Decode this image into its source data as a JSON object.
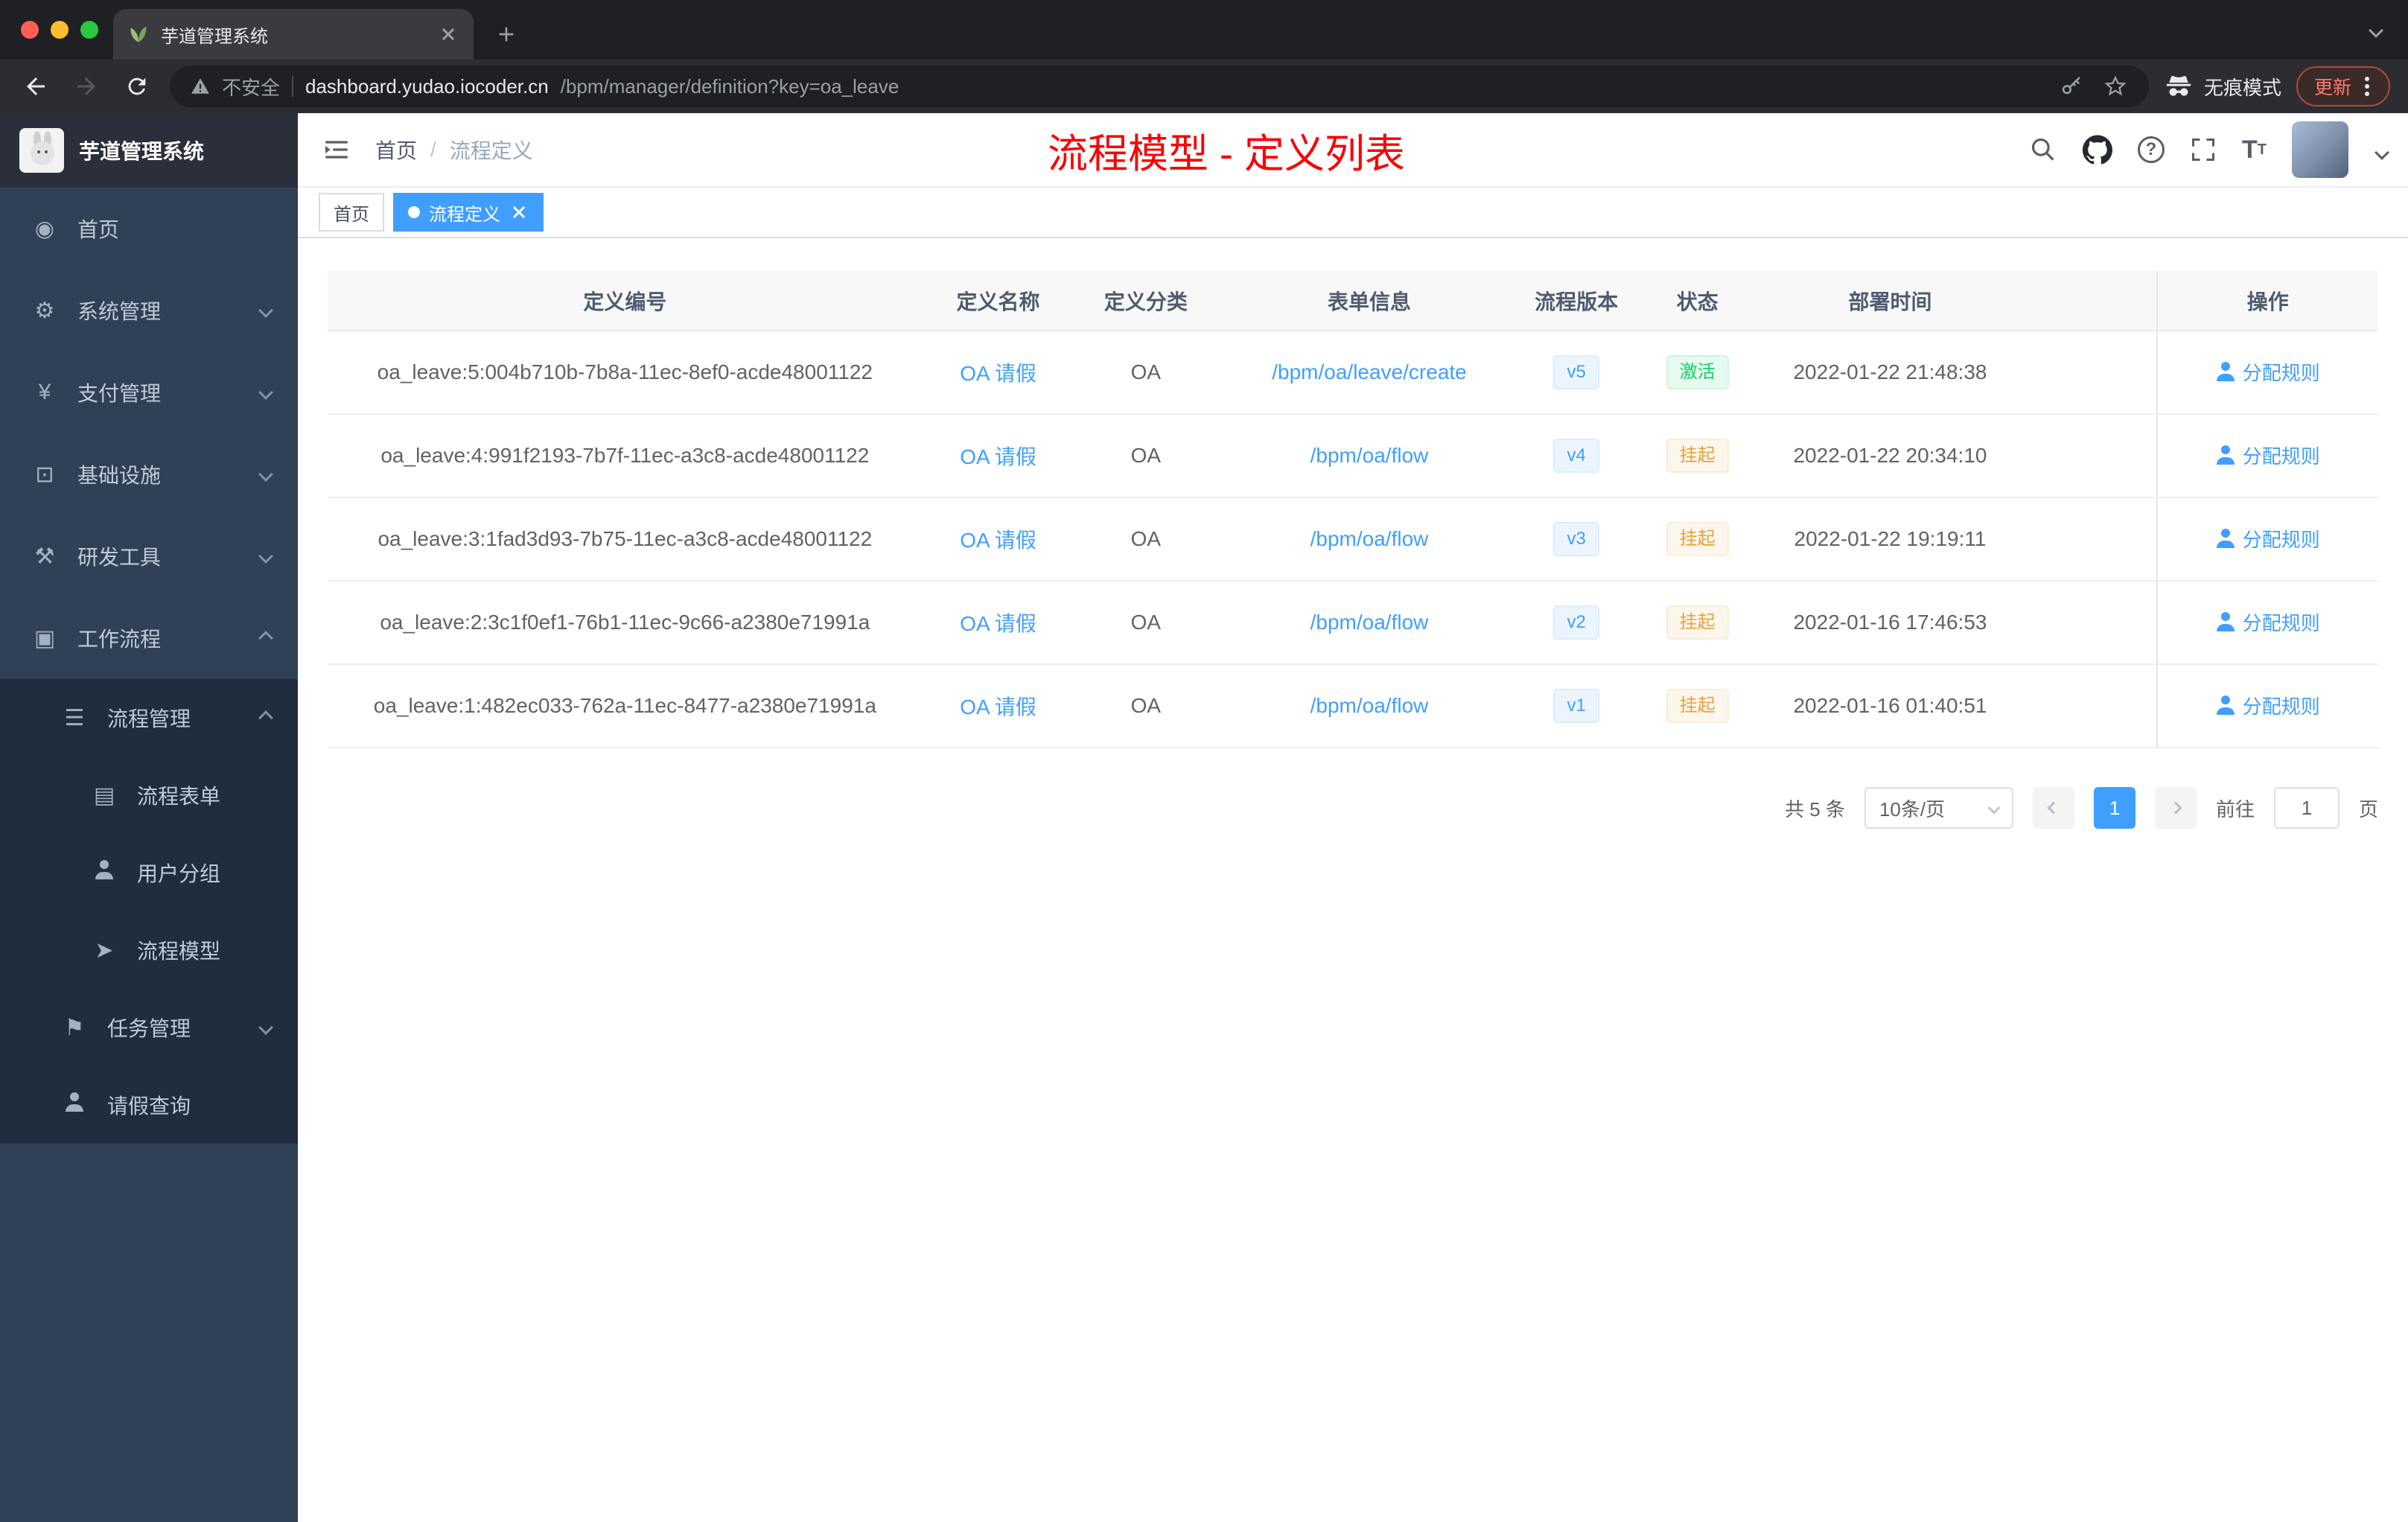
{
  "colors": {
    "accent": "#409eff",
    "success": "#13ce66",
    "warning": "#e6a23c",
    "annotation_red": "#fb0007",
    "sidebar_bg": "#304156",
    "submenu_bg": "#1f2d3d"
  },
  "browser": {
    "tab_title": "芋道管理系统",
    "not_secure": "不安全",
    "url_host": "dashboard.yudao.iocoder.cn",
    "url_path": "/bpm/manager/definition?key=oa_leave",
    "incognito": "无痕模式",
    "update": "更新"
  },
  "sidebar": {
    "title": "芋道管理系统",
    "items": [
      {
        "label": "首页",
        "icon": "dashboard-icon",
        "glyph": "◉"
      },
      {
        "label": "系统管理",
        "icon": "gear-icon",
        "glyph": "⚙",
        "expand": "down"
      },
      {
        "label": "支付管理",
        "icon": "yen-icon",
        "glyph": "¥",
        "expand": "down"
      },
      {
        "label": "基础设施",
        "icon": "infrastructure-icon",
        "glyph": "⊡",
        "expand": "down"
      },
      {
        "label": "研发工具",
        "icon": "dev-tools-icon",
        "glyph": "⚒",
        "expand": "down"
      },
      {
        "label": "工作流程",
        "icon": "workflow-icon",
        "glyph": "▣",
        "expand": "up"
      },
      {
        "label": "流程管理",
        "icon": "process-manage-icon",
        "glyph": "☰",
        "expand": "up"
      },
      {
        "label": "流程表单",
        "icon": "form-icon",
        "glyph": "▤"
      },
      {
        "label": "用户分组",
        "icon": "user-group-icon",
        "glyph": ""
      },
      {
        "label": "流程模型",
        "icon": "process-model-icon",
        "glyph": "➤"
      },
      {
        "label": "任务管理",
        "icon": "task-manage-icon",
        "glyph": "⚑",
        "expand": "down"
      },
      {
        "label": "请假查询",
        "icon": "leave-query-icon",
        "glyph": ""
      }
    ]
  },
  "header": {
    "breadcrumb_home": "首页",
    "breadcrumb_sep": "/",
    "breadcrumb_current": "流程定义",
    "overlay_title": "流程模型 - 定义列表"
  },
  "tags": {
    "home": "首页",
    "current": "流程定义"
  },
  "icons": {
    "question": "?",
    "font_large": "T",
    "font_small": "T"
  },
  "table": {
    "columns": [
      "定义编号",
      "定义名称",
      "定义分类",
      "表单信息",
      "流程版本",
      "状态",
      "部署时间",
      "操作"
    ],
    "rows": [
      {
        "id": "oa_leave:5:004b710b-7b8a-11ec-8ef0-acde48001122",
        "name": "OA 请假",
        "category": "OA",
        "form": "/bpm/oa/leave/create",
        "version": "v5",
        "status": "激活",
        "status_type": "success",
        "time": "2022-01-22 21:48:38",
        "action": "分配规则"
      },
      {
        "id": "oa_leave:4:991f2193-7b7f-11ec-a3c8-acde48001122",
        "name": "OA 请假",
        "category": "OA",
        "form": "/bpm/oa/flow",
        "version": "v4",
        "status": "挂起",
        "status_type": "warning",
        "time": "2022-01-22 20:34:10",
        "action": "分配规则"
      },
      {
        "id": "oa_leave:3:1fad3d93-7b75-11ec-a3c8-acde48001122",
        "name": "OA 请假",
        "category": "OA",
        "form": "/bpm/oa/flow",
        "version": "v3",
        "status": "挂起",
        "status_type": "warning",
        "time": "2022-01-22 19:19:11",
        "action": "分配规则"
      },
      {
        "id": "oa_leave:2:3c1f0ef1-76b1-11ec-9c66-a2380e71991a",
        "name": "OA 请假",
        "category": "OA",
        "form": "/bpm/oa/flow",
        "version": "v2",
        "status": "挂起",
        "status_type": "warning",
        "time": "2022-01-16 17:46:53",
        "action": "分配规则"
      },
      {
        "id": "oa_leave:1:482ec033-762a-11ec-8477-a2380e71991a",
        "name": "OA 请假",
        "category": "OA",
        "form": "/bpm/oa/flow",
        "version": "v1",
        "status": "挂起",
        "status_type": "warning",
        "time": "2022-01-16 01:40:51",
        "action": "分配规则"
      }
    ]
  },
  "pagination": {
    "total": "共 5 条",
    "page_size": "10条/页",
    "page": "1",
    "goto_label": "前往",
    "goto_value": "1",
    "page_unit": "页"
  }
}
